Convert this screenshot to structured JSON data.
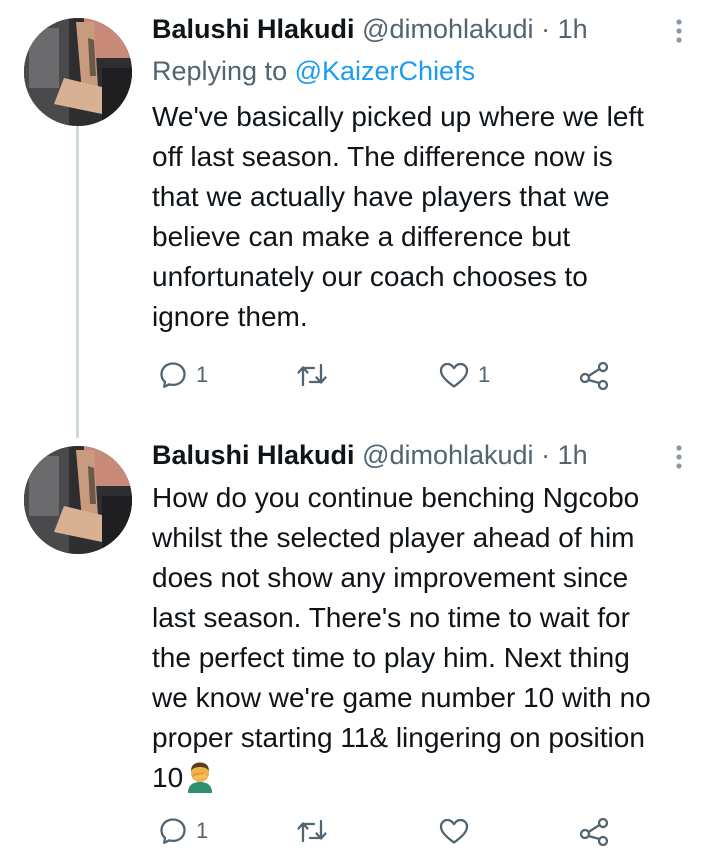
{
  "tweets": [
    {
      "display_name": "Balushi Hlakudi",
      "handle": "@dimohlakudi",
      "separator": "·",
      "time": "1h",
      "replying_prefix": "Replying to",
      "replying_handle": "@KaizerChiefs",
      "lines": [
        "We've basically picked up where we left",
        "off last season. The difference now is",
        "that we actually have players that we",
        "believe can make a difference but",
        "unfortunately our coach chooses to",
        "ignore them."
      ],
      "reply_count": "1",
      "like_count": "1"
    },
    {
      "display_name": "Balushi Hlakudi",
      "handle": "@dimohlakudi",
      "separator": "·",
      "time": "1h",
      "lines": [
        "How do you continue benching Ngcobo",
        "whilst the selected player ahead of him",
        "does not show any improvement since",
        "last season. There's no time to wait for",
        "the perfect time to play him. Next thing",
        "we know we're game number 10 with no",
        "proper starting 11& lingering on position",
        "10"
      ],
      "emoji": "person-facepalming",
      "reply_count": "1"
    }
  ],
  "icons": {
    "reply": "reply-icon",
    "retweet": "retweet-icon",
    "like": "heart-icon",
    "share": "share-icon",
    "more": "more-vertical-icon"
  },
  "colors": {
    "text": "#0f1419",
    "secondary": "#536471",
    "link": "#1d9bf0",
    "thread_line": "#cfd9de"
  }
}
